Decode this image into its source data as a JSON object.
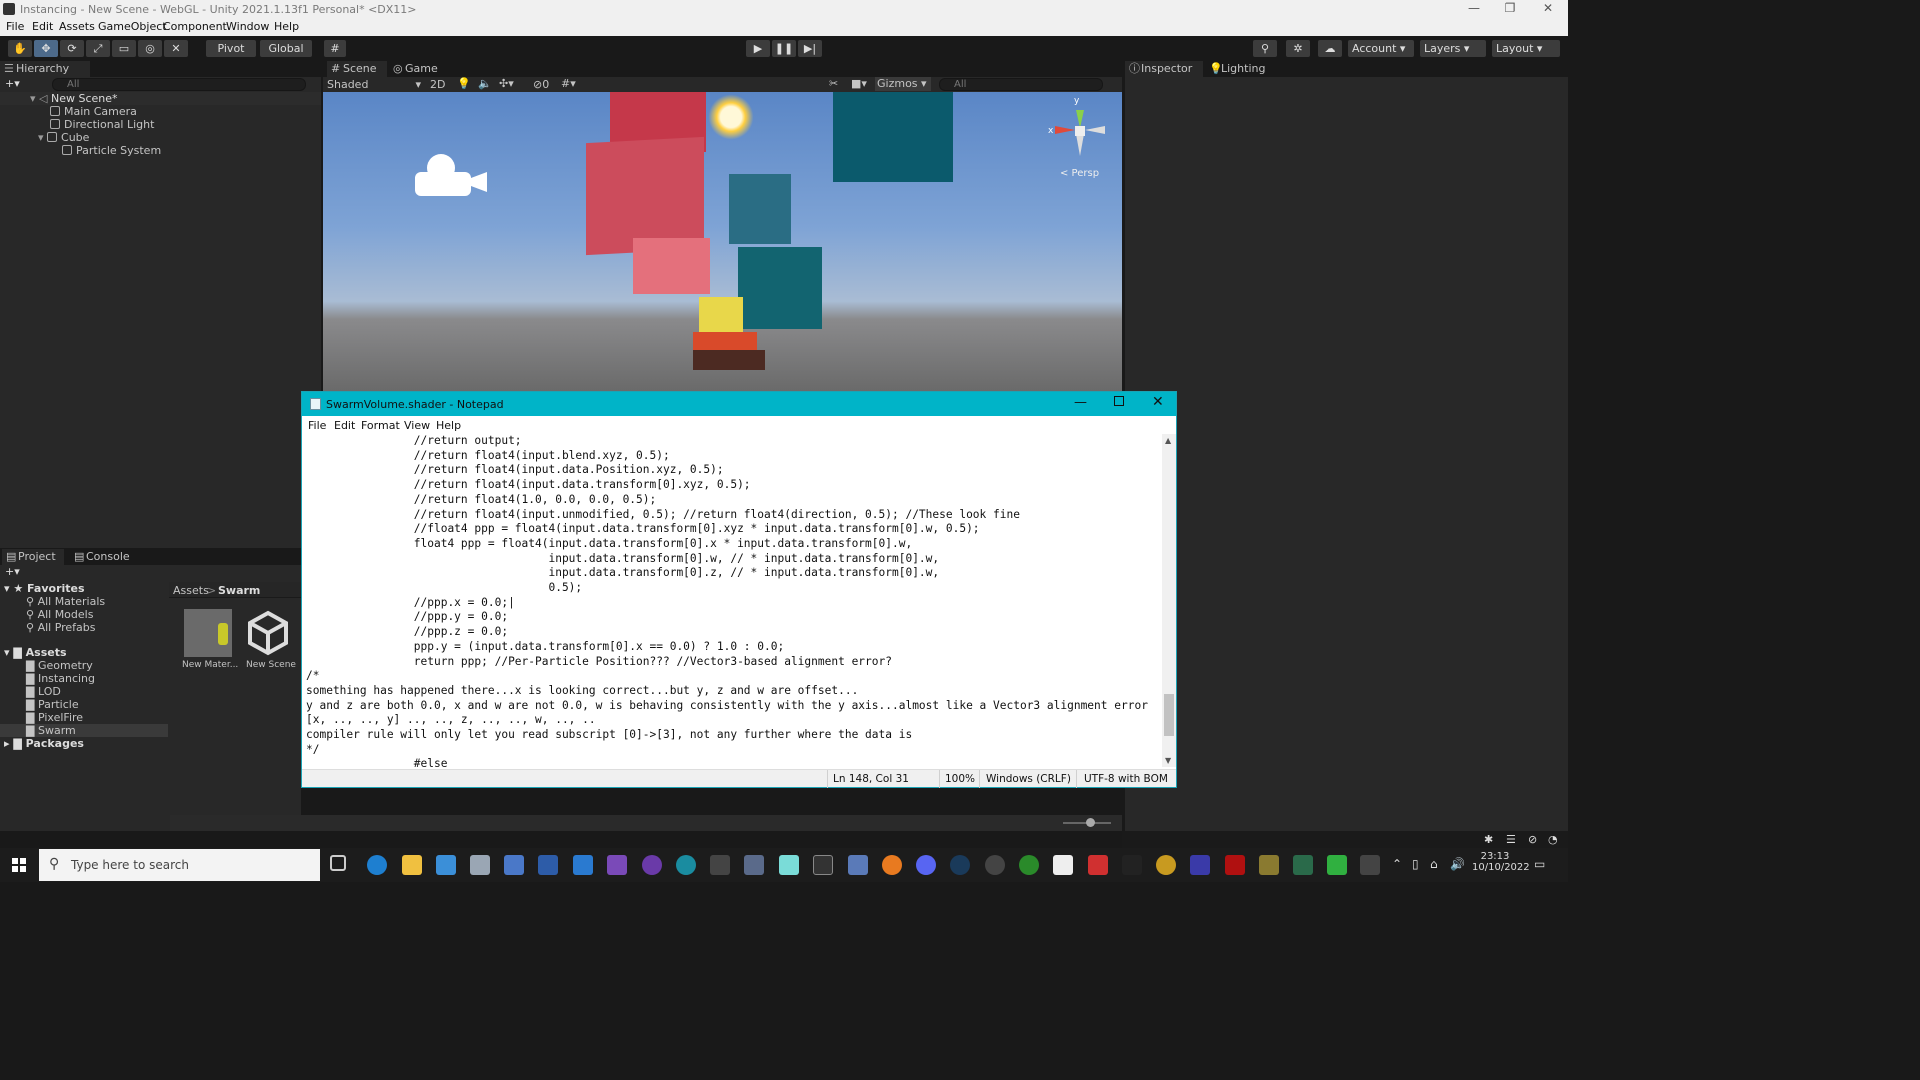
{
  "window": {
    "title": "Instancing - New Scene - WebGL - Unity 2021.1.13f1 Personal* <DX11>",
    "controls": [
      "—",
      "❐",
      "✕"
    ]
  },
  "menu": [
    "File",
    "Edit",
    "Assets",
    "GameObject",
    "Component",
    "Window",
    "Help"
  ],
  "toolbar": {
    "pivot": "Pivot",
    "global": "Global",
    "account": "Account",
    "layers": "Layers",
    "layout": "Layout"
  },
  "hierarchy": {
    "tab": "Hierarchy",
    "search_placeholder": "All",
    "scene": "New Scene*",
    "items": [
      "Main Camera",
      "Directional Light",
      "Cube",
      "Particle System"
    ]
  },
  "scene": {
    "tabs": [
      "Scene",
      "Game"
    ],
    "shading": "Shaded",
    "mode_2d": "2D",
    "fx_count": "0",
    "gizmos": "Gizmos",
    "search_placeholder": "All",
    "persp": "< Persp",
    "axes": {
      "x": "x",
      "y": "y"
    }
  },
  "inspector": {
    "tabs": [
      "Inspector",
      "Lighting"
    ]
  },
  "project": {
    "tabs": [
      "Project",
      "Console"
    ],
    "favorites_label": "Favorites",
    "favorites": [
      "All Materials",
      "All Models",
      "All Prefabs"
    ],
    "assets_label": "Assets",
    "assets": [
      "Geometry",
      "Instancing",
      "LOD",
      "Particle",
      "PixelFire",
      "Swarm"
    ],
    "packages_label": "Packages",
    "breadcrumb": [
      "Assets",
      "Swarm"
    ],
    "files": [
      "New Mater...",
      "New Scene"
    ]
  },
  "notepad": {
    "title": "SwarmVolume.shader - Notepad",
    "menu": [
      "File",
      "Edit",
      "Format",
      "View",
      "Help"
    ],
    "lines": [
      "                //return output;",
      "                //return float4(input.blend.xyz, 0.5);",
      "                //return float4(input.data.Position.xyz, 0.5);",
      "                //return float4(input.data.transform[0].xyz, 0.5);",
      "                //return float4(1.0, 0.0, 0.0, 0.5);",
      "                //return float4(input.unmodified, 0.5); //return float4(direction, 0.5); //These look fine",
      "                //float4 ppp = float4(input.data.transform[0].xyz * input.data.transform[0].w, 0.5);",
      "                float4 ppp = float4(input.data.transform[0].x * input.data.transform[0].w,",
      "                                    input.data.transform[0].w, // * input.data.transform[0].w,",
      "                                    input.data.transform[0].z, // * input.data.transform[0].w,",
      "                                    0.5);",
      "                //ppp.x = 0.0;|",
      "                //ppp.y = 0.0;",
      "                //ppp.z = 0.0;",
      "                ppp.y = (input.data.transform[0].x == 0.0) ? 1.0 : 0.0;",
      "                return ppp; //Per-Particle Position??? //Vector3-based alignment error?",
      "/*",
      "something has happened there...x is looking correct...but y, z and w are offset...",
      "y and z are both 0.0, x and w are not 0.0, w is behaving consistently with the y axis...almost like a Vector3 alignment error",
      "[x, .., .., y] .., .., z, .., .., w, .., ..",
      "compiler rule will only let you read subscript [0]->[3], not any further where the data is",
      "*/",
      "                #else"
    ],
    "status": {
      "position": "Ln 148, Col 31",
      "zoom": "100%",
      "line_ending": "Windows (CRLF)",
      "encoding": "UTF-8 with BOM"
    }
  },
  "taskbar": {
    "search_placeholder": "Type here to search",
    "time": "23:13",
    "date": "10/10/2022"
  }
}
